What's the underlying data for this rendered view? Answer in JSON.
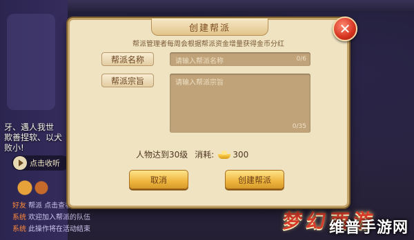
{
  "dialog": {
    "title": "创建帮派",
    "subtitle": "帮派管理者每周会根据帮派资金增量获得金币分红",
    "name_label": "帮派名称",
    "name_placeholder": "请输入帮派名称",
    "name_counter": "0/6",
    "purpose_label": "帮派宗旨",
    "purpose_placeholder": "请输入帮派宗旨",
    "purpose_counter": "0/35",
    "requirement": "人物达到30级",
    "cost_label": "消耗:",
    "cost_value": "300",
    "cancel_button": "取消",
    "create_button": "创建帮派",
    "close_symbol": "✕"
  },
  "background": {
    "chat_lines": [
      "牙、遇人我世",
      "欺善捏软、以犬",
      "败小!"
    ],
    "voice_label": "点击收听",
    "messages": [
      {
        "tag": "好友",
        "text": "帮派  点击查看"
      },
      {
        "tag": "系统",
        "text": "欢迎加入帮派的队伍"
      },
      {
        "tag": "系统",
        "text": "此操作将在活动结束"
      }
    ],
    "logo": "梦幻西游",
    "watermark": "维普手游网"
  }
}
